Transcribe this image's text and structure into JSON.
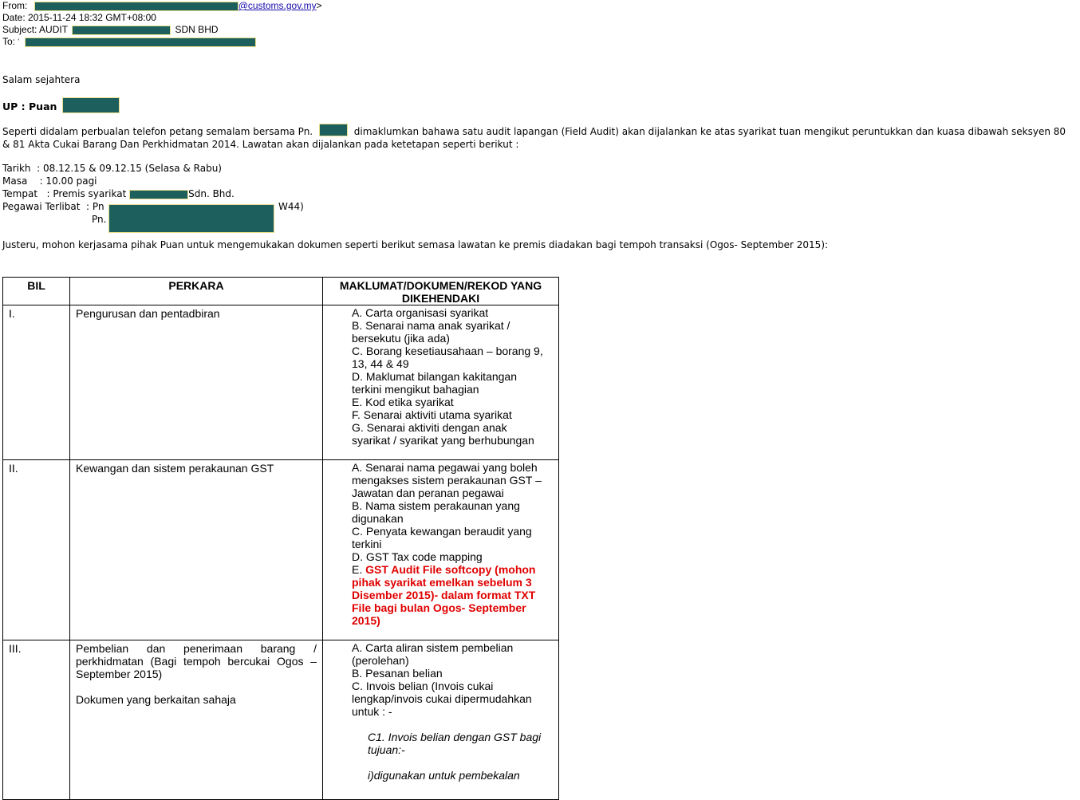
{
  "email": {
    "from_label": "From:",
    "from_domain": "@customs.gov.my",
    "from_suffix": ">",
    "date_label": "Date:",
    "date_value": "2015-11-24 18:32 GMT+08:00",
    "subject_label": "Subject:",
    "subject_prefix": "AUDIT",
    "subject_suffix": "SDN BHD",
    "to_label": "To:",
    "to_mark": "'"
  },
  "letter": {
    "greeting": "Salam sejahtera",
    "up_label": "UP : Puan",
    "intro_part1": "Seperti didalam perbualan telefon petang semalam bersama Pn.",
    "intro_part2": "dimaklumkan bahawa satu audit lapangan (Field Audit) akan dijalankan ke atas syarikat tuan mengikut peruntukkan dan kuasa dibawah seksyen 80 & 81 Akta Cukai Barang Dan Perkhidmatan 2014. Lawatan akan dijalankan pada ketetapan seperti berikut :",
    "tarikh": "Tarikh  : 08.12.15 & 09.12.15 (Selasa & Rabu)",
    "masa": "Masa    : 10.00 pagi",
    "tempat_prefix": "Tempat   : Premis syarikat",
    "tempat_suffix": "Sdn. Bhd.",
    "pegawai_prefix": "Pegawai Terlibat  : Pn",
    "pegawai_suffix": "W44)",
    "pegawai_line2": "Pn.",
    "request": "Justeru, mohon kerjasama pihak Puan  untuk mengemukakan dokumen seperti berikut semasa lawatan ke premis diadakan bagi tempoh transaksi (Ogos- September 2015):"
  },
  "table": {
    "headers": [
      "BIL",
      "PERKARA",
      "MAKLUMAT/DOKUMEN/REKOD YANG DIKEHENDAKI"
    ],
    "rows": [
      {
        "bil": "I.",
        "perkara": "Pengurusan dan pentadbiran",
        "items": [
          "A. Carta organisasi syarikat",
          "B. Senarai nama anak syarikat / bersekutu (jika ada)",
          "C. Borang kesetiausahaan – borang 9, 13, 44 & 49",
          "D. Maklumat bilangan kakitangan terkini mengikut bahagian",
          "E. Kod etika syarikat",
          "F. Senarai aktiviti utama syarikat",
          "G. Senarai aktiviti dengan anak syarikat / syarikat yang berhubungan"
        ]
      },
      {
        "bil": "II.",
        "perkara": "Kewangan dan sistem perakaunan GST",
        "items": [
          "A. Senarai nama pegawai yang boleh mengakses sistem perakaunan GST – Jawatan dan peranan pegawai",
          "B. Nama sistem perakaunan yang digunakan",
          "C. Penyata kewangan beraudit yang terkini",
          "D. GST Tax code mapping"
        ],
        "item_e_prefix": "E. ",
        "item_e_red": "GST Audit File softcopy (mohon pihak syarikat emelkan sebelum 3 Disember 2015)- dalam format TXT File bagi bulan Ogos- September 2015)"
      },
      {
        "bil": "III.",
        "perkara": "Pembelian dan penerimaan barang / perkhidmatan (Bagi tempoh bercukai Ogos – September 2015)",
        "perkara_note": "Dokumen yang berkaitan sahaja",
        "items": [
          "A. Carta aliran sistem pembelian (perolehan)",
          "B. Pesanan belian",
          "C. Invois belian (Invois cukai lengkap/invois cukai dipermudahkan untuk : -"
        ],
        "sub_c1": "C1. Invois belian dengan GST bagi tujuan:-",
        "sub_i": "i)digunakan untuk pembekalan"
      }
    ]
  },
  "colors": {
    "redaction": "#1c5f5d",
    "link": "#1a0dab",
    "alert": "#e00000"
  }
}
